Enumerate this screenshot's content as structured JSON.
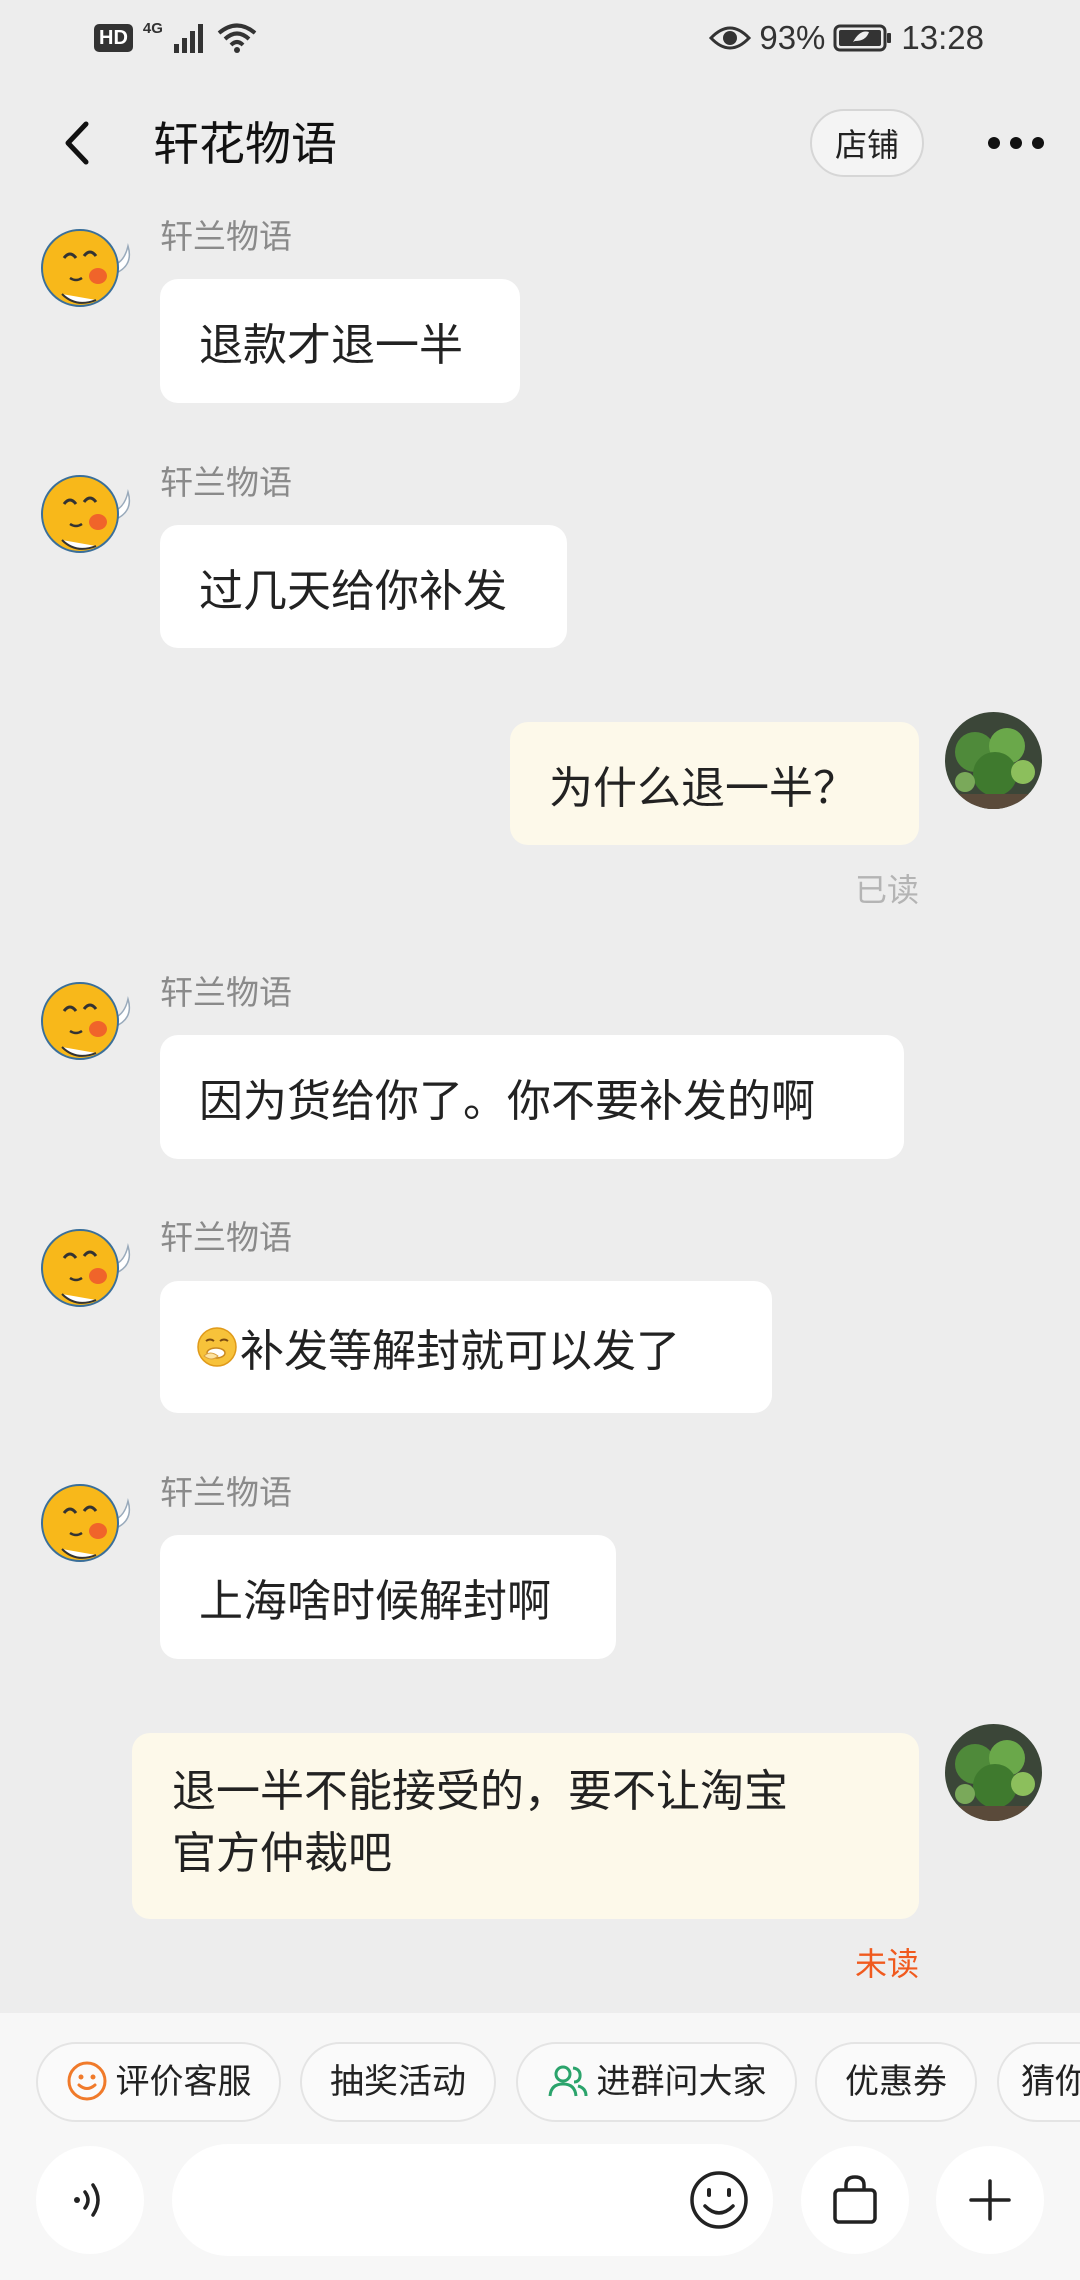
{
  "status_bar": {
    "hd_label": "HD",
    "network_label": "4G",
    "battery_percent": "93%",
    "time": "13:28"
  },
  "header": {
    "title": "轩花物语",
    "shop_button": "店铺"
  },
  "messages": [
    {
      "side": "left",
      "sender": "轩兰物语",
      "text": "退款才退一半"
    },
    {
      "side": "left",
      "sender": "轩兰物语",
      "text": "过几天给你补发"
    },
    {
      "side": "right",
      "text": "为什么退一半？",
      "status": "已读"
    },
    {
      "side": "left",
      "sender": "轩兰物语",
      "text": "因为货给你了。你不要补发的啊"
    },
    {
      "side": "left",
      "sender": "轩兰物语",
      "text": "补发等解封就可以发了",
      "emoji": "yawning-face"
    },
    {
      "side": "left",
      "sender": "轩兰物语",
      "text": "上海啥时候解封啊"
    },
    {
      "side": "right",
      "text_lines": [
        "退一半不能接受的，要不让淘宝",
        "官方仲裁吧"
      ],
      "status": "未读"
    }
  ],
  "quick_actions": [
    "评价客服",
    "抽奖活动",
    "进群问大家",
    "优惠券",
    "猜你"
  ],
  "input": {
    "placeholder": ""
  },
  "colors": {
    "background": "#ededed",
    "bubble_other": "#ffffff",
    "bubble_self": "#fdf9ea",
    "status_read": "#b4b4b4",
    "status_unread": "#f05a1e",
    "chip_icon_orange": "#f07a2a",
    "chip_icon_green": "#2aa36b"
  },
  "icons": [
    "back-arrow-icon",
    "more-dots-icon",
    "eye-icon",
    "battery-icon",
    "signal-icon",
    "wifi-icon",
    "smiley-icon",
    "group-icon",
    "voice-icon",
    "emoji-icon",
    "shopping-bag-icon",
    "plus-icon"
  ]
}
